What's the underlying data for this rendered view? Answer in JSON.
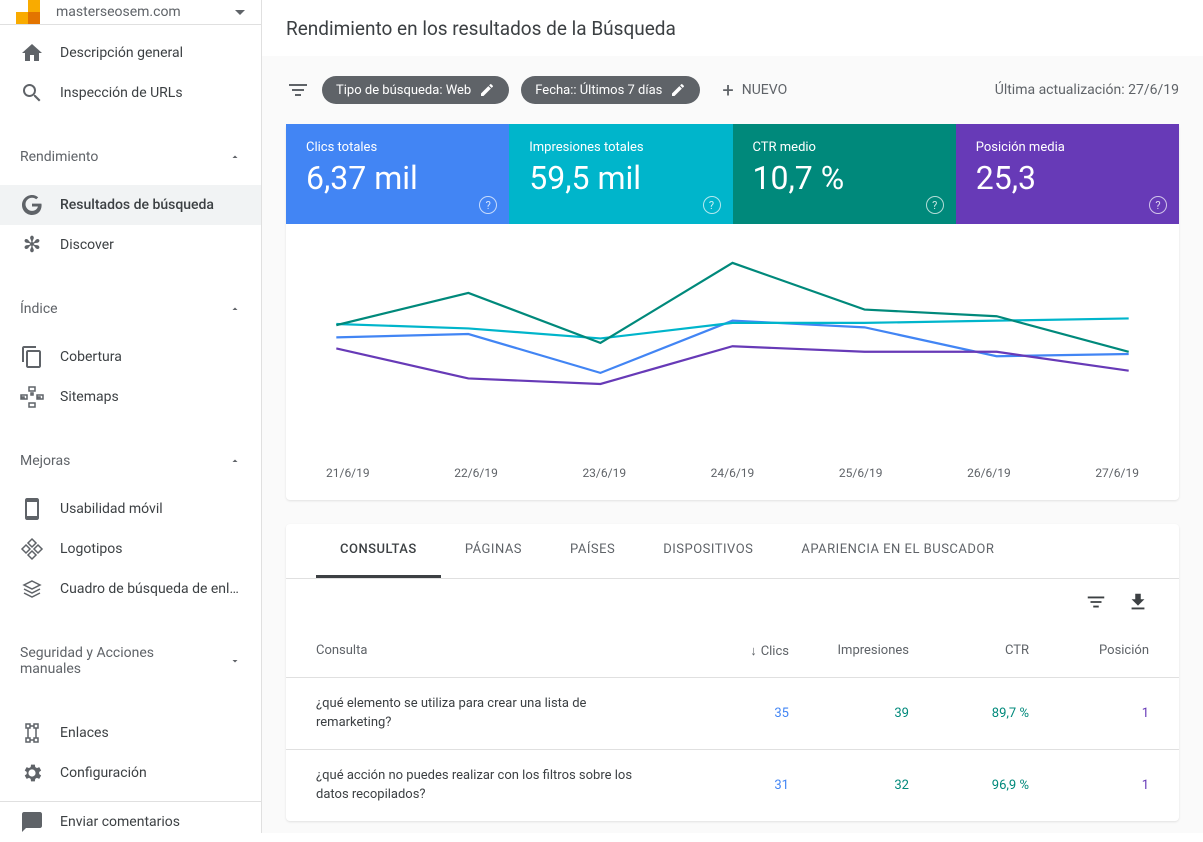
{
  "site": {
    "name": "masterseosem.com"
  },
  "nav": {
    "overview": "Descripción general",
    "url_inspect": "Inspección de URLs",
    "perf_section": "Rendimiento",
    "search_results": "Resultados de búsqueda",
    "discover": "Discover",
    "index_section": "Índice",
    "coverage": "Cobertura",
    "sitemaps": "Sitemaps",
    "enhance_section": "Mejoras",
    "mobile": "Usabilidad móvil",
    "logos": "Logotipos",
    "searchbox": "Cuadro de búsqueda de enla…",
    "security_section": "Seguridad y Acciones manuales",
    "links": "Enlaces",
    "settings": "Configuración",
    "feedback": "Enviar comentarios"
  },
  "page": {
    "title": "Rendimiento en los resultados de la Búsqueda",
    "chip_type": "Tipo de búsqueda: Web",
    "chip_date": "Fecha:: Últimos 7 días",
    "new_btn": "NUEVO",
    "last_update": "Última actualización: 27/6/19"
  },
  "metrics": {
    "clicks": {
      "label": "Clics totales",
      "value": "6,37 mil"
    },
    "impr": {
      "label": "Impresiones totales",
      "value": "59,5 mil"
    },
    "ctr": {
      "label": "CTR medio",
      "value": "10,7 %"
    },
    "pos": {
      "label": "Posición media",
      "value": "25,3"
    }
  },
  "chart_data": {
    "type": "line",
    "categories": [
      "21/6/19",
      "22/6/19",
      "23/6/19",
      "24/6/19",
      "25/6/19",
      "26/6/19",
      "27/6/19"
    ],
    "series": [
      {
        "name": "Clics totales",
        "color": "#4285f4",
        "ys": [
          75,
          72,
          107,
          60,
          66,
          92,
          90
        ]
      },
      {
        "name": "Impresiones totales",
        "color": "#00b5cb",
        "ys": [
          63,
          67,
          76,
          62,
          62,
          60,
          58
        ]
      },
      {
        "name": "CTR medio",
        "color": "#00897b",
        "ys": [
          64,
          35,
          80,
          8,
          50,
          56,
          88
        ]
      },
      {
        "name": "Posición media",
        "color": "#673ab7",
        "ys": [
          85,
          112,
          117,
          83,
          88,
          88,
          105
        ]
      }
    ],
    "note": "ys are pixel y-coords in a 0–180 viewport (lower value = higher on chart); numeric axis values not shown in source image"
  },
  "table": {
    "tabs": [
      "CONSULTAS",
      "PÁGINAS",
      "PAÍSES",
      "DISPOSITIVOS",
      "APARIENCIA EN EL BUSCADOR"
    ],
    "active_tab": 0,
    "headers": {
      "query": "Consulta",
      "clicks": "Clics",
      "impr": "Impresiones",
      "ctr": "CTR",
      "pos": "Posición"
    },
    "rows": [
      {
        "query": "¿qué elemento se utiliza para crear una lista de remarketing?",
        "clicks": "35",
        "impr": "39",
        "ctr": "89,7 %",
        "pos": "1"
      },
      {
        "query": "¿qué acción no puedes realizar con los filtros sobre los datos recopilados?",
        "clicks": "31",
        "impr": "32",
        "ctr": "96,9 %",
        "pos": "1"
      }
    ]
  }
}
